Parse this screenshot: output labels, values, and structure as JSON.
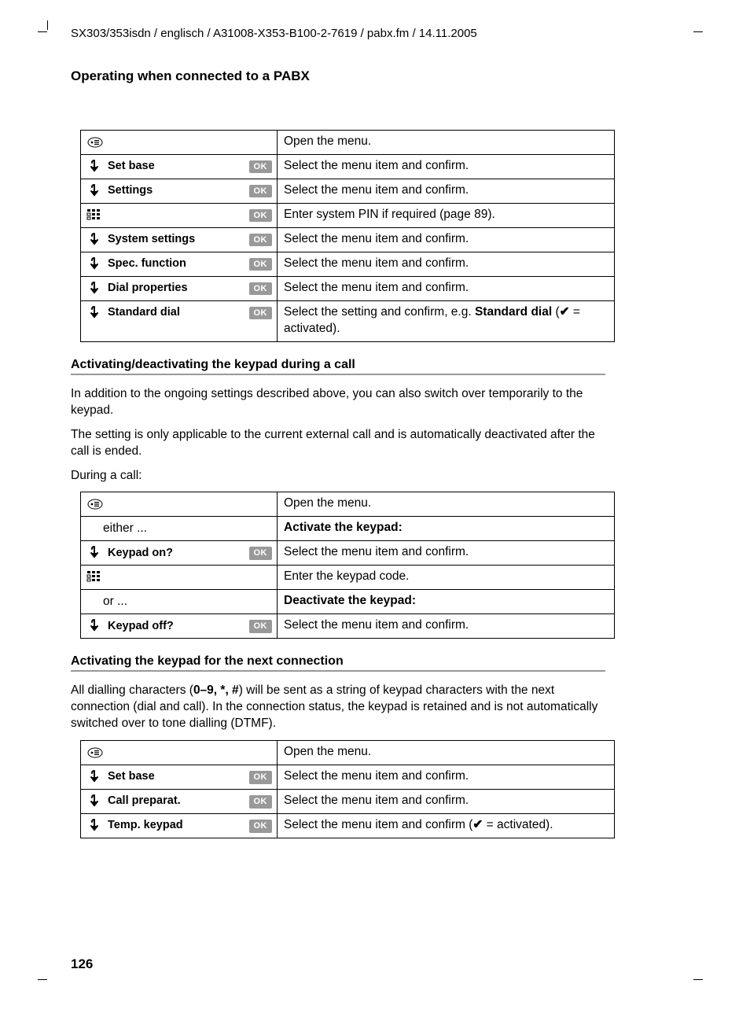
{
  "header_path": "SX303/353isdn / englisch / A31008-X353-B100-2-7619 / pabx.fm / 14.11.2005",
  "section_title": "Operating when connected to a PABX",
  "table1": {
    "rows": [
      {
        "icon": "menu",
        "label": "",
        "ok": false,
        "desc": "Open the menu."
      },
      {
        "icon": "down",
        "label": "Set base",
        "ok": true,
        "desc": "Select the menu item and confirm."
      },
      {
        "icon": "down",
        "label": "Settings",
        "ok": true,
        "desc": "Select the menu item and confirm."
      },
      {
        "icon": "keypad",
        "label": "",
        "ok": true,
        "desc": "Enter system PIN if required (page 89)."
      },
      {
        "icon": "down",
        "label": "System settings",
        "ok": true,
        "desc": "Select the menu item and confirm."
      },
      {
        "icon": "down",
        "label": "Spec. function",
        "ok": true,
        "desc": "Select the menu item and confirm."
      },
      {
        "icon": "down",
        "label": "Dial properties",
        "ok": true,
        "desc": "Select the menu item and confirm."
      },
      {
        "icon": "down",
        "label": "Standard dial",
        "ok": true,
        "desc_html": true
      }
    ],
    "last_desc_prefix": "Select the setting and confirm, e.g. ",
    "last_desc_bold": "Standard dial",
    "last_desc_suffix1": " (",
    "last_desc_check": "✔",
    "last_desc_suffix2": " = activated)."
  },
  "sub1_title": "Activating/deactivating the keypad during a call",
  "sub1_p1": "In addition to the ongoing settings described above, you can also switch over temporarily to the keypad.",
  "sub1_p2": "The setting is only applicable to the current external call and is automatically deactivated after the call is ended.",
  "sub1_p3": "During a call:",
  "table2": {
    "rows": [
      {
        "icon": "menu",
        "label": "",
        "ok": false,
        "desc": "Open the menu."
      },
      {
        "plain_left": "either ...",
        "desc_bold": "Activate the keypad:"
      },
      {
        "icon": "down",
        "label": "Keypad on?",
        "ok": true,
        "desc": "Select the menu item and confirm."
      },
      {
        "icon": "keypad",
        "label": "",
        "ok": false,
        "desc": "Enter the keypad code."
      },
      {
        "plain_left": "or ...",
        "desc_bold": "Deactivate the keypad:"
      },
      {
        "icon": "down",
        "label": "Keypad off?",
        "ok": true,
        "desc": "Select the menu item and confirm."
      }
    ]
  },
  "sub2_title": "Activating the keypad for the next connection",
  "sub2_p1_a": "All dialling characters (",
  "sub2_p1_bold": "0–9, *, #",
  "sub2_p1_b": ") will be sent as a string of keypad characters with the next connection (dial and call). In the connection status, the keypad is retained and is not automatically switched over to tone dialling (DTMF).",
  "table3": {
    "rows": [
      {
        "icon": "menu",
        "label": "",
        "ok": false,
        "desc": "Open the menu."
      },
      {
        "icon": "down",
        "label": "Set base",
        "ok": true,
        "desc": "Select the menu item and confirm."
      },
      {
        "icon": "down",
        "label": "Call preparat.",
        "ok": true,
        "desc": "Select the menu item and confirm."
      },
      {
        "icon": "down",
        "label": "Temp. keypad",
        "ok": true,
        "desc_html": true
      }
    ],
    "last_desc_prefix": "Select the menu item and confirm (",
    "last_desc_check": "✔",
    "last_desc_suffix": " = activated)."
  },
  "ok_label": "OK",
  "page_number": "126"
}
